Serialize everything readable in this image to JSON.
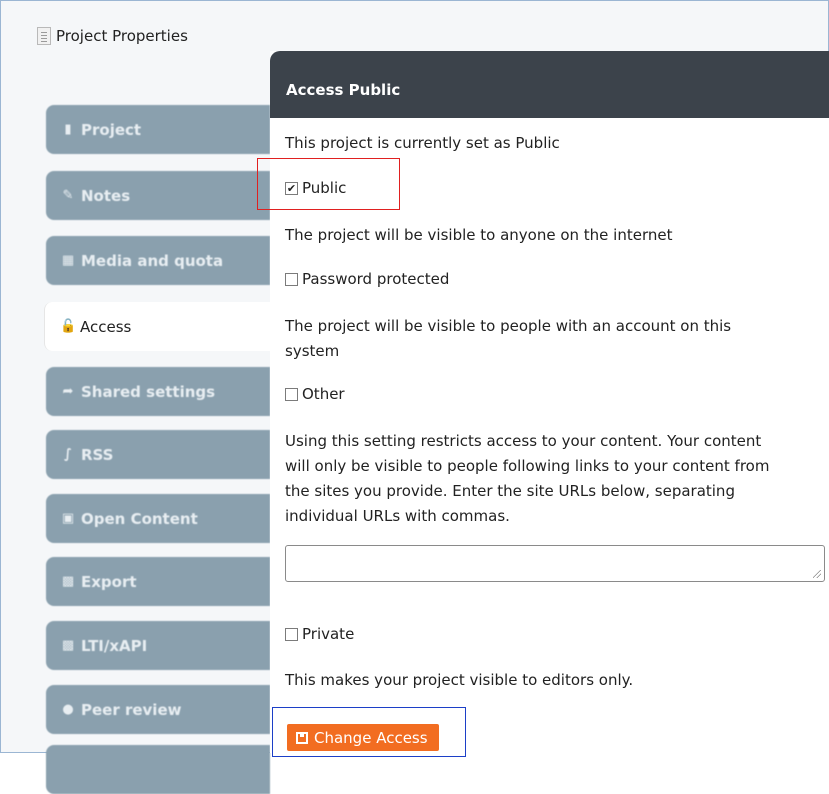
{
  "window": {
    "title": "Project Properties",
    "icon": "document-icon"
  },
  "sidebar": {
    "items": [
      {
        "label": "Project",
        "icon": "file-icon",
        "active": false
      },
      {
        "label": "Notes",
        "icon": "edit-icon",
        "active": false
      },
      {
        "label": "Media and quota",
        "icon": "film-icon",
        "active": false
      },
      {
        "label": "Access",
        "icon": "unlock-icon",
        "active": true
      },
      {
        "label": "Shared settings",
        "icon": "share-icon",
        "active": false
      },
      {
        "label": "RSS",
        "icon": "rss-icon",
        "active": false
      },
      {
        "label": "Open Content",
        "icon": "image-icon",
        "active": false
      },
      {
        "label": "Export",
        "icon": "save-icon",
        "active": false
      },
      {
        "label": "LTI/xAPI",
        "icon": "save-icon",
        "active": false
      },
      {
        "label": "Peer review",
        "icon": "comment-icon",
        "active": false
      }
    ]
  },
  "panel": {
    "header": "Access Public",
    "status": "This project is currently set as Public",
    "options": {
      "public": {
        "label": "Public",
        "checked": true
      },
      "public_desc": "The project will be visible to anyone on the internet",
      "password": {
        "label": "Password protected",
        "checked": false
      },
      "password_desc_1": "The project will be visible to people with an account on this",
      "password_desc_2": "system",
      "other": {
        "label": "Other",
        "checked": false
      },
      "other_desc_1": "Using this setting restricts access to your content. Your content",
      "other_desc_2": "will only be visible to people following links to your content from",
      "other_desc_3": "the sites you provide. Enter the site URLs below, separating",
      "other_desc_4": "individual URLs with commas.",
      "urls_value": "",
      "private": {
        "label": "Private",
        "checked": false
      },
      "private_desc": "This makes your project visible to editors only."
    },
    "button_label": "Change Access"
  },
  "colors": {
    "tab_inactive": "#8aa0ae",
    "header_bg": "#3c434b",
    "button_bg": "#f26d21",
    "highlight_red": "#e02020",
    "highlight_blue": "#1c3fc7"
  }
}
